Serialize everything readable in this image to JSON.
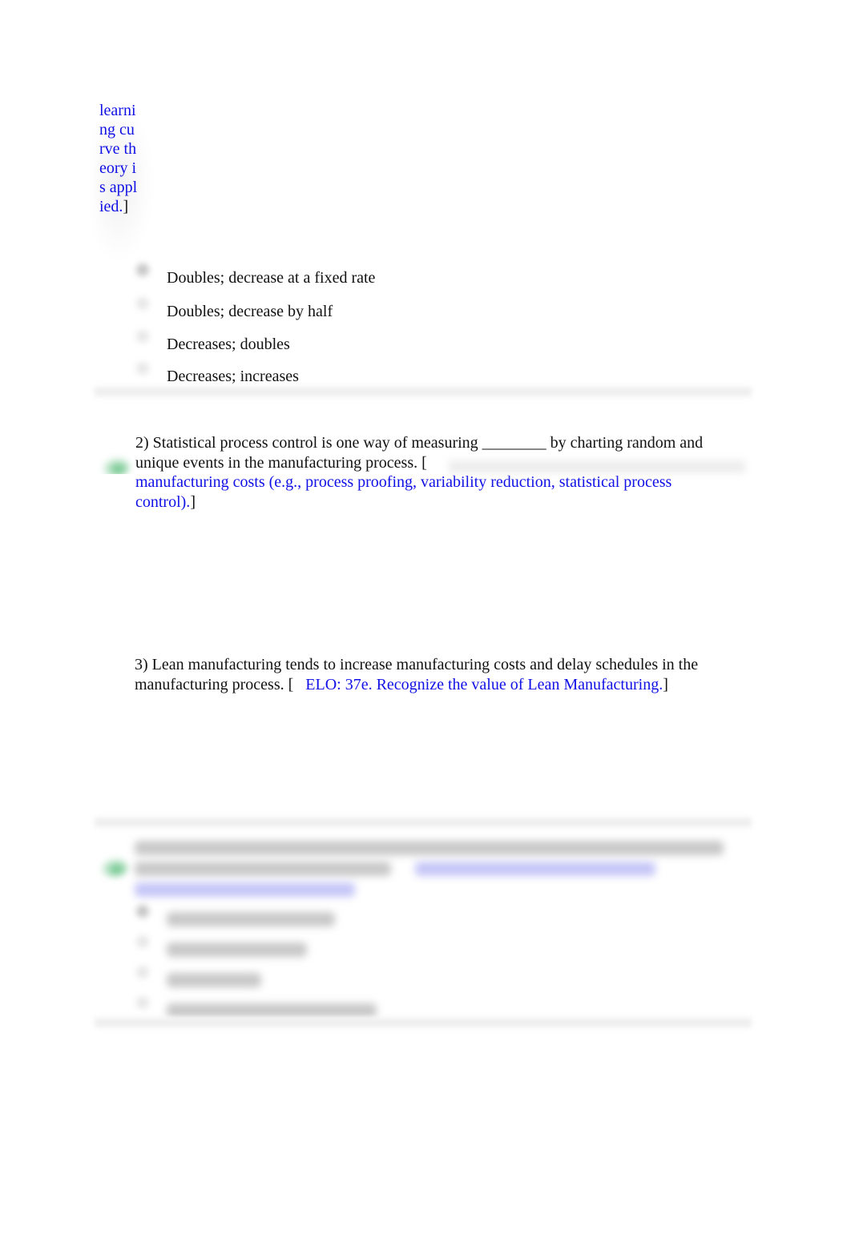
{
  "question1_tail": {
    "elo_link_fragment": "learning curve theory is applied.",
    "closing_bracket": "]",
    "options": [
      {
        "label": "Doubles; decrease at a fixed rate",
        "selected": true
      },
      {
        "label": "Doubles; decrease by half",
        "selected": false
      },
      {
        "label": "Decreases; doubles",
        "selected": false
      },
      {
        "label": "Decreases; increases",
        "selected": false
      }
    ]
  },
  "question2": {
    "text_line1": "2) Statistical process control is one way of measuring ________ by charting random and",
    "text_line2": "unique events in the manufacturing process. [",
    "link_line1": "manufacturing costs (e.g., process proofing, variability reduction, statistical process",
    "link_line2": "control).",
    "closing_bracket": "]",
    "status": "correct"
  },
  "question3": {
    "text_line1": "3) Lean manufacturing tends to increase manufacturing costs and delay schedules in the",
    "text_line2": "manufacturing process. [",
    "link": "ELO: 37e. Recognize the value of Lean Manufacturing.",
    "closing_bracket": "]"
  },
  "question4": {
    "status": "correct",
    "content": "blurred",
    "option_count": 4
  },
  "colors": {
    "link": "#1010e6",
    "text": "#111111",
    "correct_check": "#5fbf7f"
  }
}
